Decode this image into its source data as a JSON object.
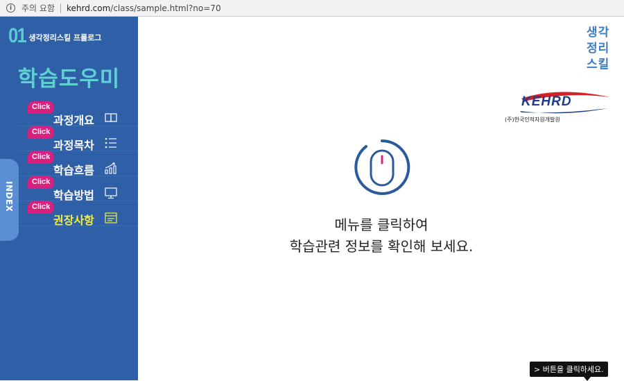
{
  "address_bar": {
    "security_text": "주의 요함",
    "url_host": "kehrd.com",
    "url_path": "/class/sample.html?no=70"
  },
  "sidebar": {
    "number": "01",
    "subtitle": "생각정리스킬 프롤로그",
    "title": "학습도우미",
    "index_tab": "INDEX",
    "items": [
      {
        "badge": "Click",
        "label": "과정개요",
        "icon": "book-icon"
      },
      {
        "badge": "Click",
        "label": "과정목차",
        "icon": "list-icon"
      },
      {
        "badge": "Click",
        "label": "학습흐름",
        "icon": "growth-chart-icon"
      },
      {
        "badge": "Click",
        "label": "학습방법",
        "icon": "monitor-icon"
      },
      {
        "badge": "Click",
        "label": "권장사항",
        "icon": "checklist-icon"
      }
    ],
    "colors": {
      "background": "#2e5fa7",
      "title": "#5fd0d3",
      "badge": "#d9207e",
      "active": "#f3ef3a"
    }
  },
  "main": {
    "logo_text": [
      "생각",
      "정리",
      "스킬"
    ],
    "kehrd_name": "KEHRD",
    "kehrd_org": "(주)한국인적자원개발원",
    "message_line1": "메뉴를 클릭하여",
    "message_line2": "학습관련 정보를 확인해 보세요.",
    "tooltip": "> 버튼을 클릭하세요."
  }
}
